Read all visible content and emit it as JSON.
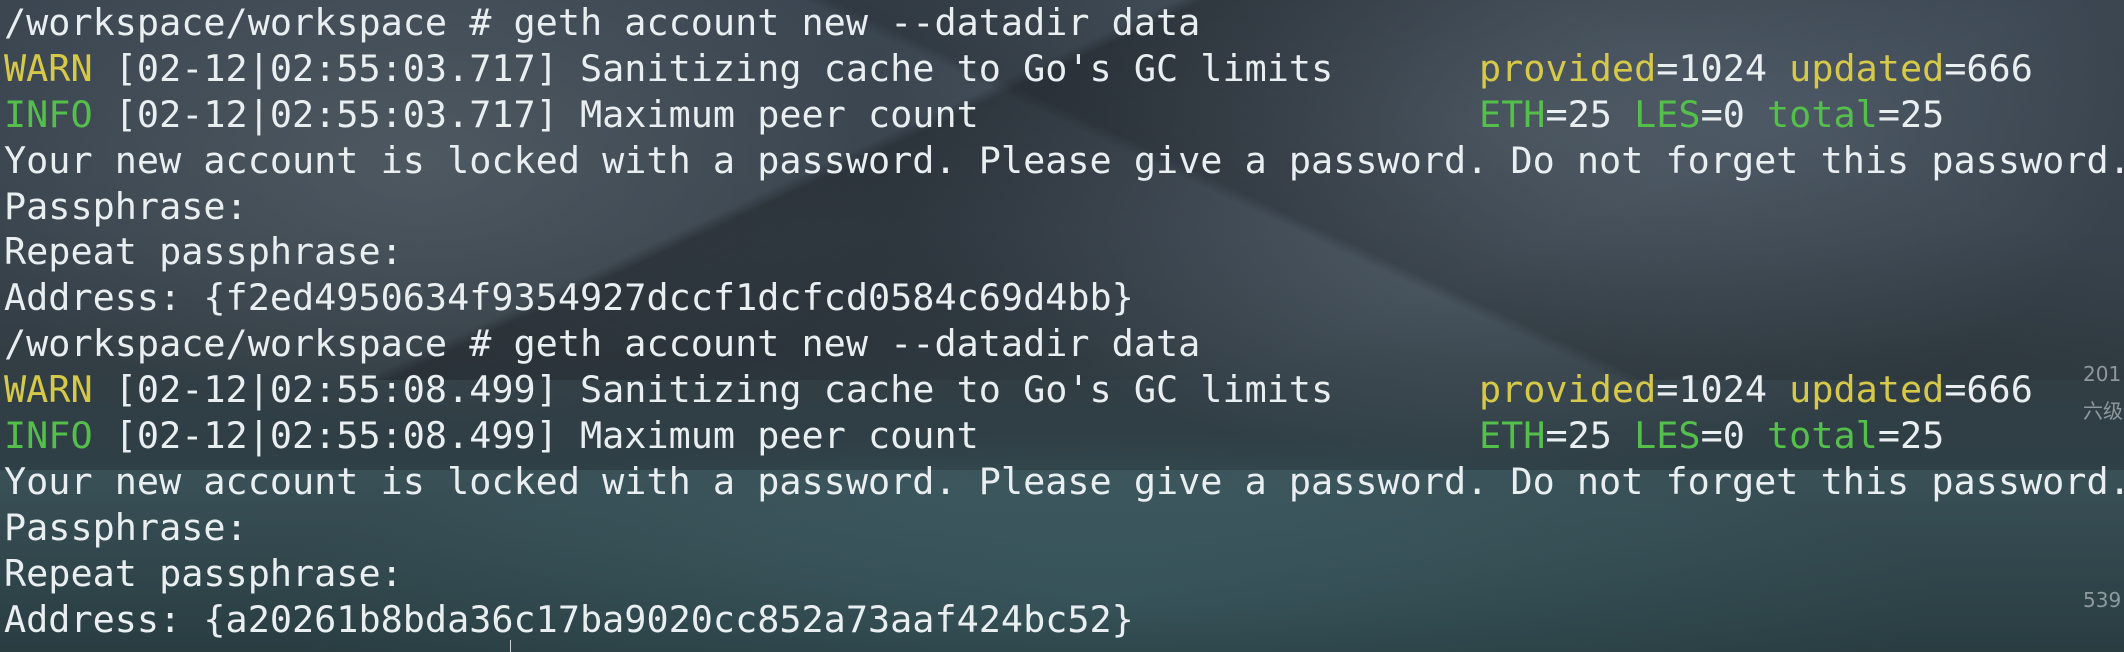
{
  "terminal": {
    "lines": [
      {
        "type": "cmd",
        "text": "/workspace/workspace # geth account new --datadir data"
      },
      {
        "type": "log",
        "level": "WARN",
        "level_class": "warn",
        "msg": " [02-12|02:55:03.717] Sanitizing cache to Go's GC limits",
        "kv": [
          {
            "k": "provided",
            "v": "1024"
          },
          {
            "k": "updated",
            "v": "666"
          }
        ]
      },
      {
        "type": "log",
        "level": "INFO",
        "level_class": "info",
        "msg": " [02-12|02:55:03.717] Maximum peer count",
        "kv": [
          {
            "k": "ETH",
            "v": "25"
          },
          {
            "k": "LES",
            "v": "0"
          },
          {
            "k": "total",
            "v": "25"
          }
        ]
      },
      {
        "type": "text",
        "text": "Your new account is locked with a password. Please give a password. Do not forget this password."
      },
      {
        "type": "text",
        "text": "Passphrase:"
      },
      {
        "type": "text",
        "text": "Repeat passphrase:"
      },
      {
        "type": "text",
        "text": "Address: {f2ed4950634f9354927dccf1dcfcd0584c69d4bb}"
      },
      {
        "type": "cmd",
        "text": "/workspace/workspace # geth account new --datadir data"
      },
      {
        "type": "log",
        "level": "WARN",
        "level_class": "warn",
        "msg": " [02-12|02:55:08.499] Sanitizing cache to Go's GC limits",
        "kv": [
          {
            "k": "provided",
            "v": "1024"
          },
          {
            "k": "updated",
            "v": "666"
          }
        ]
      },
      {
        "type": "log",
        "level": "INFO",
        "level_class": "info",
        "msg": " [02-12|02:55:08.499] Maximum peer count",
        "kv": [
          {
            "k": "ETH",
            "v": "25"
          },
          {
            "k": "LES",
            "v": "0"
          },
          {
            "k": "total",
            "v": "25"
          }
        ]
      },
      {
        "type": "text",
        "text": "Your new account is locked with a password. Please give a password. Do not forget this password."
      },
      {
        "type": "text",
        "text": "Passphrase:"
      },
      {
        "type": "text",
        "text": "Repeat passphrase:"
      },
      {
        "type": "text",
        "text": "Address: {a20261b8bda36c17ba9020cc852a73aaf424bc52}"
      }
    ]
  },
  "desktop_side_text": [
    "201",
    "六级",
    "539"
  ],
  "colors": {
    "warn": "#d6c94a",
    "info": "#54c04b",
    "text": "#e9eef1"
  }
}
